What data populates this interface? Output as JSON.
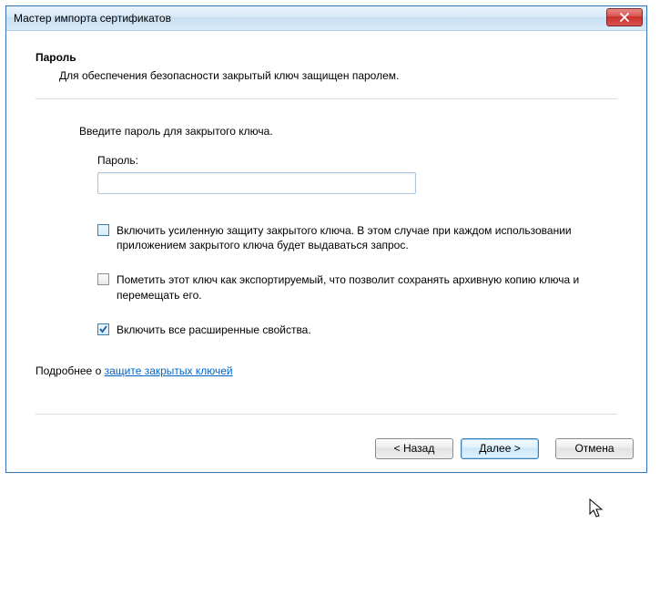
{
  "window": {
    "title": "Мастер импорта сертификатов"
  },
  "section": {
    "heading": "Пароль",
    "description": "Для обеспечения безопасности закрытый ключ защищен паролем."
  },
  "prompt": "Введите пароль для закрытого ключа.",
  "password": {
    "label": "Пароль:",
    "value": ""
  },
  "options": {
    "strong_protection": {
      "label": "Включить усиленную защиту закрытого ключа. В этом случае при каждом использовании приложением закрытого ключа будет выдаваться запрос.",
      "checked": false,
      "highlighted": true
    },
    "exportable": {
      "label": "Пометить этот ключ как экспортируемый, что позволит сохранять архивную копию ключа и перемещать его.",
      "checked": false,
      "highlighted": false
    },
    "all_extended": {
      "label": "Включить все расширенные свойства.",
      "checked": true,
      "highlighted": false
    }
  },
  "more": {
    "prefix": "Подробнее о ",
    "link": "защите закрытых ключей"
  },
  "buttons": {
    "back": "< Назад",
    "next": "Далее >",
    "cancel": "Отмена"
  }
}
